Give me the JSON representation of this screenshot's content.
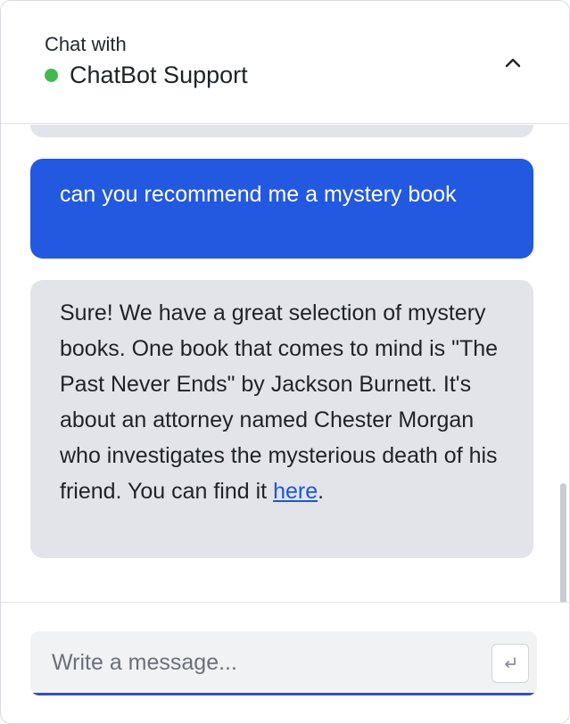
{
  "header": {
    "subtitle": "Chat with",
    "title": "ChatBot Support",
    "status_color": "#3fb950",
    "collapse_icon": "chevron-up-icon"
  },
  "messages": [
    {
      "role": "user",
      "text": "can you recommend me a mystery book"
    },
    {
      "role": "bot",
      "text_before_link": "Sure! We have a great selection of mystery books. One book that comes to mind is \"The Past Never Ends\" by Jackson Burnett. It's about an attorney named Chester Morgan who investigates the mysterious death of his friend. You can find it ",
      "link_text": "here",
      "text_after_link": "."
    }
  ],
  "composer": {
    "placeholder": "Write a message...",
    "value": "",
    "send_icon": "enter-return-icon"
  },
  "colors": {
    "user_bubble": "#2259e0",
    "bot_bubble": "#e2e4e9",
    "accent_underline": "#3b4cc0"
  }
}
